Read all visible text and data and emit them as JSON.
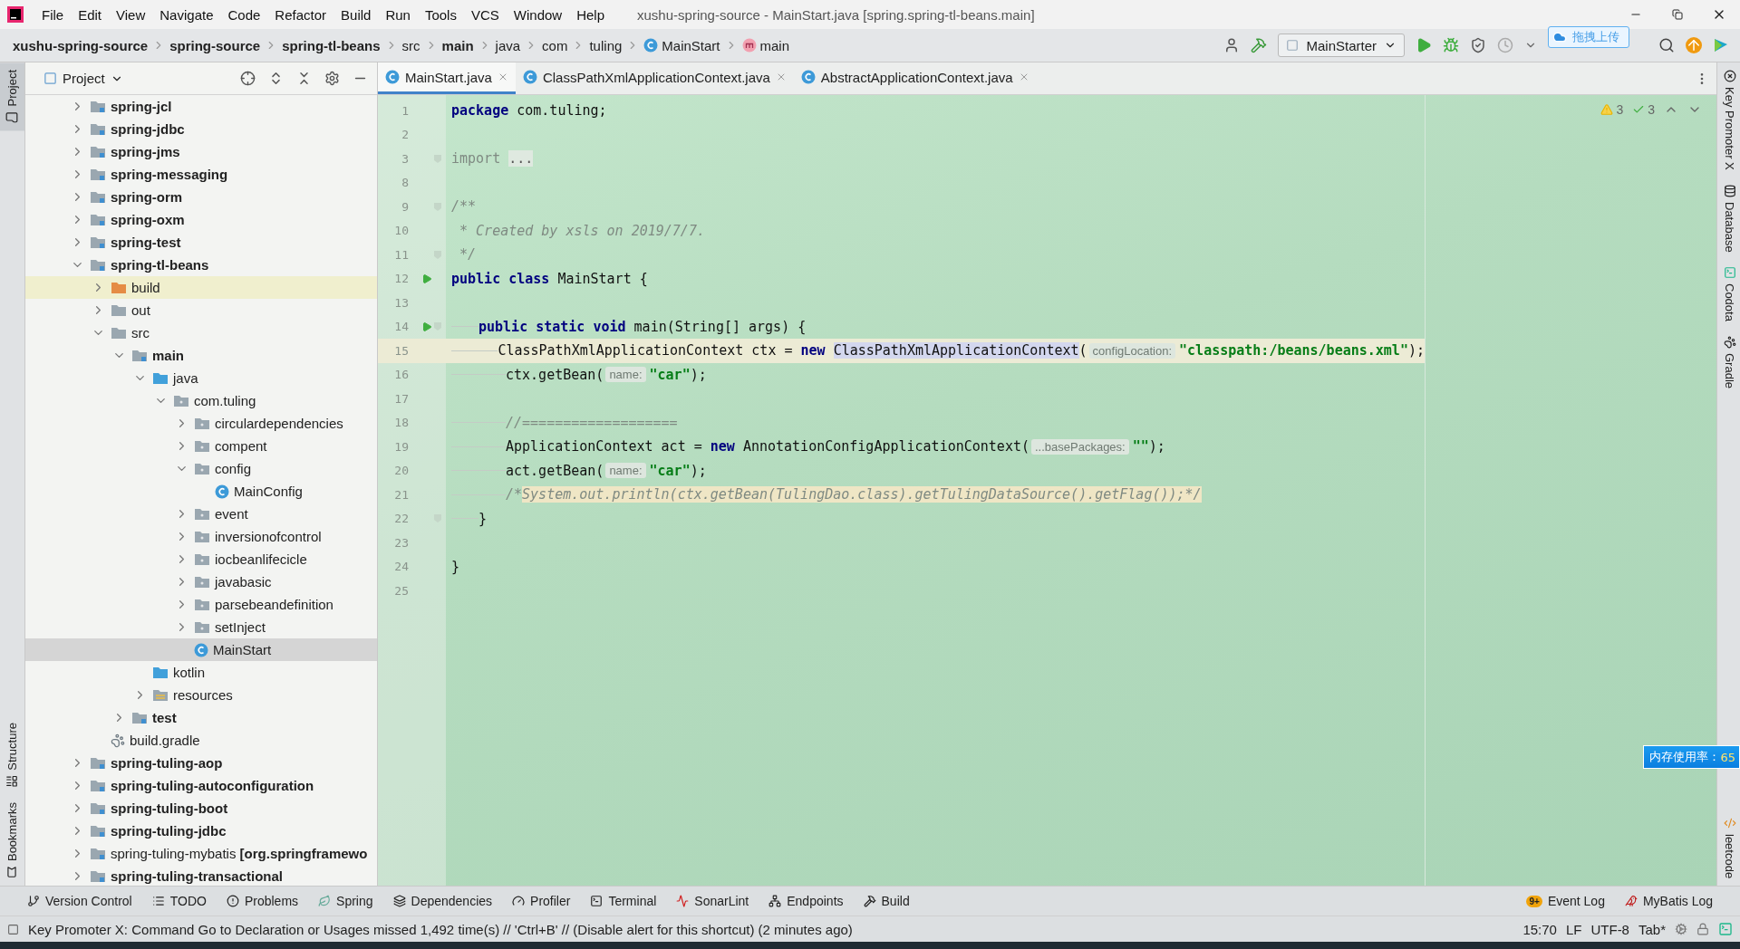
{
  "title_bar": {
    "menus": [
      "File",
      "Edit",
      "View",
      "Navigate",
      "Code",
      "Refactor",
      "Build",
      "Run",
      "Tools",
      "VCS",
      "Window",
      "Help"
    ],
    "title": "xushu-spring-source - MainStart.java [spring.spring-tl-beans.main]"
  },
  "nav_bar": {
    "breadcrumbs": [
      {
        "label": "xushu-spring-source",
        "kind": "text",
        "bold": true
      },
      {
        "label": "spring-source",
        "kind": "text",
        "bold": true
      },
      {
        "label": "spring-tl-beans",
        "kind": "text",
        "bold": true
      },
      {
        "label": "src",
        "kind": "text",
        "bold": false
      },
      {
        "label": "main",
        "kind": "text",
        "bold": true
      },
      {
        "label": "java",
        "kind": "text",
        "bold": false
      },
      {
        "label": "com",
        "kind": "text",
        "bold": false
      },
      {
        "label": "tuling",
        "kind": "text",
        "bold": false
      },
      {
        "label": "MainStart",
        "kind": "class",
        "bold": false
      },
      {
        "label": "main",
        "kind": "method",
        "bold": false
      }
    ],
    "run_config": "MainStarter",
    "upload_widget": "拖拽上传"
  },
  "left_strip": {
    "top": [
      {
        "label": "Project",
        "kind": "project",
        "selected": true
      }
    ],
    "bottom": [
      {
        "label": "Structure",
        "kind": "structure",
        "selected": false
      },
      {
        "label": "Bookmarks",
        "kind": "bookmarks",
        "selected": false
      }
    ]
  },
  "project_panel": {
    "title": "Project",
    "tree": [
      {
        "label": "spring-jcl",
        "kind": "module",
        "bold": true,
        "expanded": false,
        "selected": false
      },
      {
        "label": "spring-jdbc",
        "kind": "module",
        "bold": true,
        "expanded": false,
        "selected": false
      },
      {
        "label": "spring-jms",
        "kind": "module",
        "bold": true,
        "expanded": false,
        "selected": false
      },
      {
        "label": "spring-messaging",
        "kind": "module",
        "bold": true,
        "expanded": false,
        "selected": false
      },
      {
        "label": "spring-orm",
        "kind": "module",
        "bold": true,
        "expanded": false,
        "selected": false
      },
      {
        "label": "spring-oxm",
        "kind": "module",
        "bold": true,
        "expanded": false,
        "selected": false
      },
      {
        "label": "spring-test",
        "kind": "module",
        "bold": true,
        "expanded": false,
        "selected": false
      },
      {
        "label": "spring-tl-beans",
        "kind": "module",
        "bold": true,
        "expanded": true,
        "selected": false,
        "children": [
          {
            "label": "build",
            "kind": "excluded",
            "bold": false,
            "expanded": false,
            "selected": false
          },
          {
            "label": "out",
            "kind": "folder",
            "bold": false,
            "expanded": false,
            "selected": false
          },
          {
            "label": "src",
            "kind": "folder",
            "bold": false,
            "expanded": true,
            "selected": false,
            "children": [
              {
                "label": "main",
                "kind": "module",
                "bold": true,
                "expanded": true,
                "selected": false,
                "children": [
                  {
                    "label": "java",
                    "kind": "source",
                    "bold": false,
                    "expanded": true,
                    "selected": false,
                    "children": [
                      {
                        "label": "com.tuling",
                        "kind": "package",
                        "bold": false,
                        "expanded": true,
                        "selected": false,
                        "children": [
                          {
                            "label": "circulardependencies",
                            "kind": "package",
                            "bold": false,
                            "expanded": false,
                            "selected": false
                          },
                          {
                            "label": "compent",
                            "kind": "package",
                            "bold": false,
                            "expanded": false,
                            "selected": false
                          },
                          {
                            "label": "config",
                            "kind": "package",
                            "bold": false,
                            "expanded": true,
                            "selected": false,
                            "children": [
                              {
                                "label": "MainConfig",
                                "kind": "class",
                                "bold": false,
                                "selected": false
                              }
                            ]
                          },
                          {
                            "label": "event",
                            "kind": "package",
                            "bold": false,
                            "expanded": false,
                            "selected": false
                          },
                          {
                            "label": "inversionofcontrol",
                            "kind": "package",
                            "bold": false,
                            "expanded": false,
                            "selected": false
                          },
                          {
                            "label": "iocbeanlifecicle",
                            "kind": "package",
                            "bold": false,
                            "expanded": false,
                            "selected": false
                          },
                          {
                            "label": "javabasic",
                            "kind": "package",
                            "bold": false,
                            "expanded": false,
                            "selected": false
                          },
                          {
                            "label": "parsebeandefinition",
                            "kind": "package",
                            "bold": false,
                            "expanded": false,
                            "selected": false
                          },
                          {
                            "label": "setInject",
                            "kind": "package",
                            "bold": false,
                            "expanded": false,
                            "selected": false
                          },
                          {
                            "label": "MainStart",
                            "kind": "class",
                            "bold": false,
                            "selected": true
                          }
                        ]
                      }
                    ]
                  },
                  {
                    "label": "kotlin",
                    "kind": "source",
                    "bold": false,
                    "selected": false
                  },
                  {
                    "label": "resources",
                    "kind": "resources",
                    "bold": false,
                    "expanded": false,
                    "selected": false
                  }
                ]
              },
              {
                "label": "test",
                "kind": "module",
                "bold": true,
                "expanded": false,
                "selected": false
              }
            ]
          },
          {
            "label": "build.gradle",
            "kind": "gradle",
            "bold": false,
            "selected": false
          }
        ]
      },
      {
        "label": "spring-tuling-aop",
        "kind": "module",
        "bold": true,
        "expanded": false,
        "selected": false
      },
      {
        "label": "spring-tuling-autoconfiguration",
        "kind": "module",
        "bold": true,
        "expanded": false,
        "selected": false
      },
      {
        "label": "spring-tuling-boot",
        "kind": "module",
        "bold": true,
        "expanded": false,
        "selected": false
      },
      {
        "label": "spring-tuling-jdbc",
        "kind": "module",
        "bold": true,
        "expanded": false,
        "selected": false
      },
      {
        "label": "spring-tuling-mybatis **[org.springframewo**",
        "kind": "module",
        "bold": false,
        "expanded": false,
        "selected": false
      },
      {
        "label": "spring-tuling-transactional",
        "kind": "module",
        "bold": true,
        "expanded": false,
        "selected": false
      }
    ]
  },
  "editor": {
    "tabs": [
      {
        "label": "MainStart.java",
        "selected": true
      },
      {
        "label": "ClassPathXmlApplicationContext.java",
        "selected": false
      },
      {
        "label": "AbstractApplicationContext.java",
        "selected": false
      }
    ],
    "warnings": "3",
    "typos": "3",
    "lines": [
      {
        "number": "1",
        "run": false,
        "fold": false,
        "current": false,
        "segments": [
          {
            "kind": "keyword",
            "text": "package"
          },
          {
            "kind": "plain",
            "text": " com.tuling;"
          }
        ]
      },
      {
        "number": "2",
        "run": false,
        "fold": false,
        "current": false
      },
      {
        "number": "3",
        "run": false,
        "fold": true,
        "current": false,
        "segments": [
          {
            "kind": "import",
            "text": "import"
          },
          {
            "kind": "folded",
            "text": "..."
          }
        ]
      },
      {
        "number": "8",
        "run": false,
        "fold": false,
        "current": false
      },
      {
        "number": "9",
        "run": false,
        "fold": true,
        "current": false,
        "segments": [
          {
            "kind": "comment",
            "text": "/**"
          }
        ]
      },
      {
        "number": "10",
        "run": false,
        "fold": false,
        "current": false,
        "segments": [
          {
            "kind": "comment",
            "text": " * Created by xsls on 2019/7/7."
          }
        ]
      },
      {
        "number": "11",
        "run": false,
        "fold": true,
        "current": false,
        "segments": [
          {
            "kind": "comment",
            "text": " */"
          }
        ]
      },
      {
        "number": "12",
        "run": true,
        "fold": false,
        "current": false,
        "segments": [
          {
            "kind": "keyword",
            "text": "public class"
          },
          {
            "kind": "plain",
            "text": " MainStart {"
          }
        ]
      },
      {
        "number": "13",
        "run": false,
        "fold": false,
        "current": false
      },
      {
        "number": "14",
        "run": true,
        "fold": true,
        "current": false,
        "segments": [
          {
            "kind": "guide"
          },
          {
            "kind": "keyword",
            "text": "public static void"
          },
          {
            "kind": "plain",
            "text": " main(String[] args) {"
          }
        ]
      },
      {
        "number": "15",
        "run": false,
        "fold": false,
        "current": true,
        "segments": [
          {
            "kind": "guide"
          },
          {
            "kind": "guide"
          },
          {
            "kind": "plain",
            "text": "ClassPathXmlApplicationContext ctx = "
          },
          {
            "kind": "keyword",
            "text": "new"
          },
          {
            "kind": "reference",
            "text": "ClassPathXmlApplicationContext"
          },
          {
            "kind": "plain",
            "text": "("
          },
          {
            "kind": "hint",
            "text": "configLocation:"
          },
          {
            "kind": "string",
            "text": "\"classpath:/beans/beans.xml\""
          },
          {
            "kind": "plain",
            "text": ");"
          }
        ]
      },
      {
        "number": "16",
        "run": false,
        "fold": false,
        "current": false,
        "segments": [
          {
            "kind": "guide"
          },
          {
            "kind": "guide"
          },
          {
            "kind": "plain",
            "text": "ctx.getBean("
          },
          {
            "kind": "hint",
            "text": "name:"
          },
          {
            "kind": "string",
            "text": "\"car\""
          },
          {
            "kind": "plain",
            "text": ");"
          }
        ]
      },
      {
        "number": "17",
        "run": false,
        "fold": false,
        "current": false
      },
      {
        "number": "18",
        "run": false,
        "fold": false,
        "current": false,
        "segments": [
          {
            "kind": "guide"
          },
          {
            "kind": "guide"
          },
          {
            "kind": "comment",
            "text": "//==================="
          }
        ]
      },
      {
        "number": "19",
        "run": false,
        "fold": false,
        "current": false,
        "segments": [
          {
            "kind": "guide"
          },
          {
            "kind": "guide"
          },
          {
            "kind": "plain",
            "text": "ApplicationContext act = "
          },
          {
            "kind": "keyword",
            "text": "new"
          },
          {
            "kind": "plain",
            "text": " AnnotationConfigApplicationContext("
          },
          {
            "kind": "hint",
            "text": "...basePackages:"
          },
          {
            "kind": "string",
            "text": "\"\""
          },
          {
            "kind": "plain",
            "text": ");"
          }
        ]
      },
      {
        "number": "20",
        "run": false,
        "fold": false,
        "current": false,
        "segments": [
          {
            "kind": "guide"
          },
          {
            "kind": "guide"
          },
          {
            "kind": "plain",
            "text": "act.getBean("
          },
          {
            "kind": "hint",
            "text": "name:"
          },
          {
            "kind": "string",
            "text": "\"car\""
          },
          {
            "kind": "plain",
            "text": ");"
          }
        ]
      },
      {
        "number": "21",
        "run": false,
        "fold": false,
        "current": false,
        "segments": [
          {
            "kind": "guide"
          },
          {
            "kind": "guide"
          },
          {
            "kind": "comment",
            "text": "/*"
          },
          {
            "kind": "marked-comment",
            "text": "System.out.println(ctx.getBean(TulingDao.class).getTulingDataSource().getFlag());*/"
          }
        ]
      },
      {
        "number": "22",
        "run": false,
        "fold": true,
        "current": false,
        "segments": [
          {
            "kind": "guide"
          },
          {
            "kind": "plain",
            "text": "}"
          }
        ]
      },
      {
        "number": "23",
        "run": false,
        "fold": false,
        "current": false
      },
      {
        "number": "24",
        "run": false,
        "fold": false,
        "current": false,
        "segments": [
          {
            "kind": "plain",
            "text": "}"
          }
        ]
      },
      {
        "number": "25",
        "run": false,
        "fold": false,
        "current": false
      }
    ]
  },
  "right_strip": {
    "top": [
      {
        "label": "Key Promoter X",
        "kind": "keypromoter"
      },
      {
        "label": "Database",
        "kind": "database"
      },
      {
        "label": "Codota",
        "kind": "codota"
      },
      {
        "label": "Gradle",
        "kind": "gradle"
      }
    ],
    "bottom": [
      {
        "label": "leetcode",
        "kind": "leetcode"
      }
    ]
  },
  "memory_widget": {
    "label": "内存使用率：",
    "value": "65"
  },
  "tool_windows": {
    "left": [
      {
        "label": "Version Control",
        "kind": "vcs"
      },
      {
        "label": "TODO",
        "kind": "todo"
      },
      {
        "label": "Problems",
        "kind": "problems"
      },
      {
        "label": "Spring",
        "kind": "spring"
      },
      {
        "label": "Dependencies",
        "kind": "dependencies"
      },
      {
        "label": "Profiler",
        "kind": "profiler"
      },
      {
        "label": "Terminal",
        "kind": "terminal"
      },
      {
        "label": "SonarLint",
        "kind": "sonarlint"
      },
      {
        "label": "Endpoints",
        "kind": "endpoints"
      },
      {
        "label": "Build",
        "kind": "build"
      }
    ],
    "right": [
      {
        "label": "Event Log",
        "kind": "eventlog",
        "badge": "9+"
      },
      {
        "label": "MyBatis Log",
        "kind": "mybatis"
      }
    ]
  },
  "status_bar": {
    "message": "Key Promoter X: Command Go to Declaration or Usages missed 1,492 time(s) // 'Ctrl+B' // (Disable alert for this shortcut) (2 minutes ago)",
    "items": [
      "15:70",
      "LF",
      "UTF-8",
      "Tab*"
    ]
  }
}
